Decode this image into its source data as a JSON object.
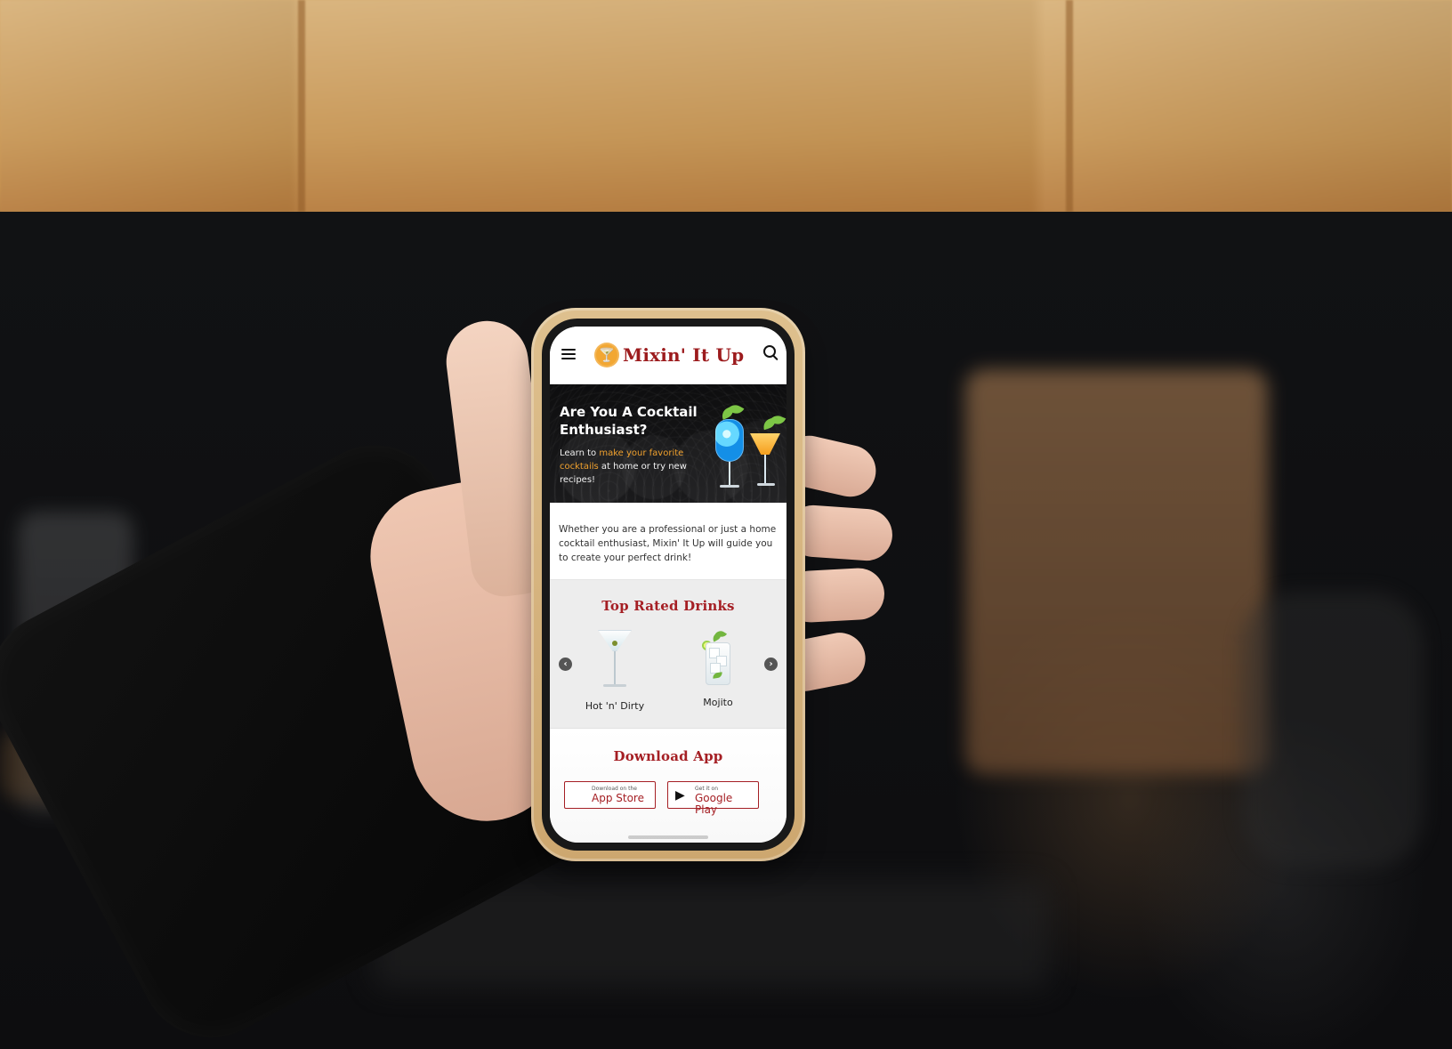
{
  "header": {
    "logo_text": "Mixin' It Up",
    "logo_mark": "🍸"
  },
  "hero": {
    "title": "Are You A Cocktail Enthusiast?",
    "copy_prefix": "Learn to ",
    "copy_accent": "make your favorite cocktails",
    "copy_suffix": " at home or try new recipes!"
  },
  "intro": {
    "text": "Whether you are a professional or just a home cocktail enthusiast, Mixin' It Up will guide you to create your perfect drink!"
  },
  "top_rated": {
    "title": "Top Rated Drinks",
    "items": [
      {
        "label": "Hot 'n' Dirty"
      },
      {
        "label": "Mojito"
      }
    ],
    "left_arrow": "‹",
    "right_arrow": "›"
  },
  "download": {
    "title": "Download App",
    "apple_small": "Download on the",
    "apple_big": "App Store",
    "google_small": "Get it on",
    "google_big": "Google Play"
  },
  "icons": {
    "menu": "menu-icon",
    "search": "search-icon",
    "apple": "apple-icon",
    "google_play": "google-play-icon",
    "left_arrow": "chevron-left-icon",
    "right_arrow": "chevron-right-icon"
  },
  "colors": {
    "brand_red": "#a51f24",
    "brand_gold": "#f2a733",
    "phone_case": "#cda76f"
  }
}
